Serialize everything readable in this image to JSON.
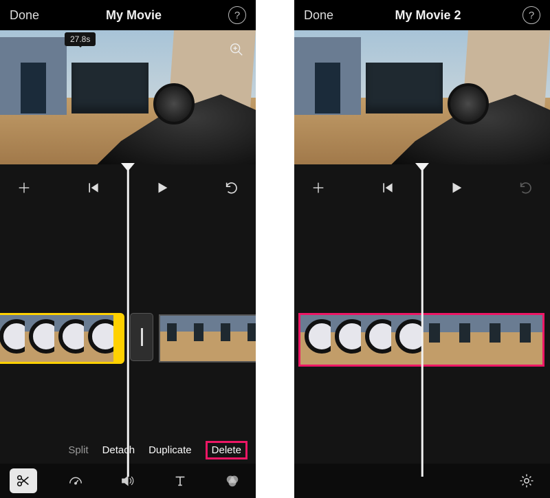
{
  "left": {
    "header": {
      "done": "Done",
      "title": "My Movie",
      "help": "?"
    },
    "preview": {
      "timestamp": "27.8s"
    },
    "actions": {
      "split": "Split",
      "detach": "Detach",
      "duplicate": "Duplicate",
      "delete": "Delete"
    },
    "icons": {
      "add": "add-icon",
      "prev": "skip-back-icon",
      "play": "play-icon",
      "undo": "undo-icon",
      "scissors": "scissors-icon",
      "speed": "speedometer-icon",
      "volume": "volume-icon",
      "text": "text-icon",
      "filters": "filters-icon",
      "zoom": "zoom-icon",
      "help": "help-icon"
    }
  },
  "right": {
    "header": {
      "done": "Done",
      "title": "My Movie 2",
      "help": "?"
    },
    "icons": {
      "add": "add-icon",
      "prev": "skip-back-icon",
      "play": "play-icon",
      "undo": "undo-icon",
      "gear": "gear-icon",
      "help": "help-icon"
    }
  }
}
